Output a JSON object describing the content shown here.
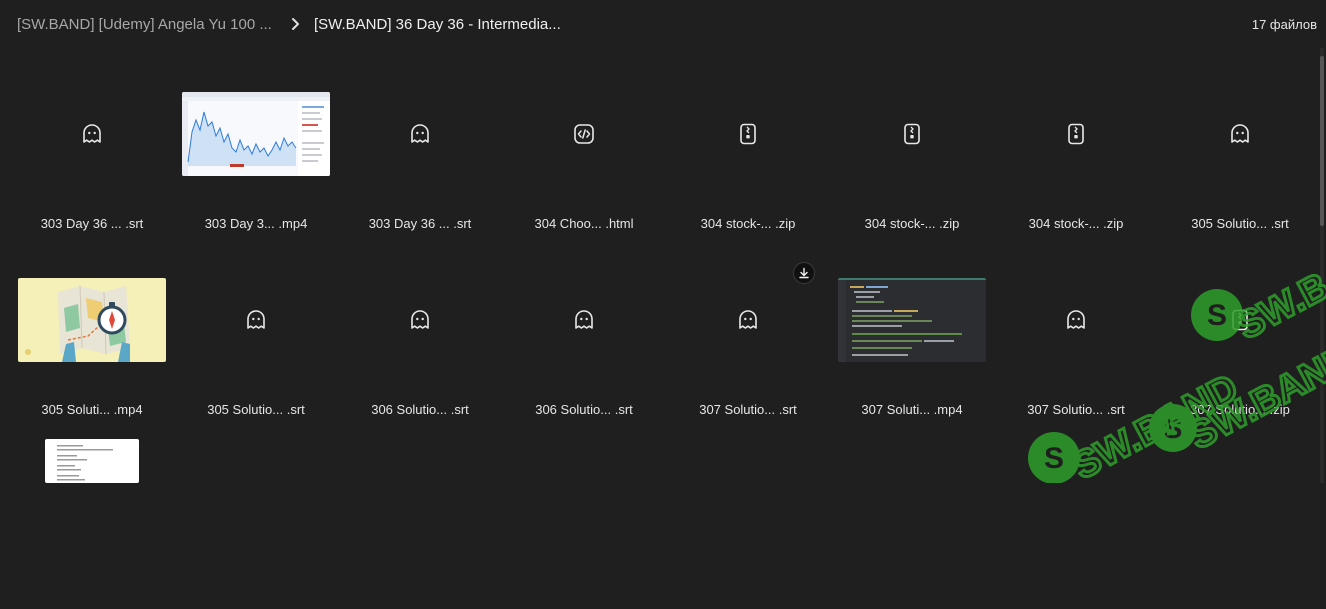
{
  "breadcrumb": {
    "parent": "[SW.BAND] [Udemy] Angela Yu 100 ...",
    "current": "[SW.BAND] 36 Day 36 - Intermedia..."
  },
  "file_count": "17 файлов",
  "files": [
    {
      "name": "303 Day 36 ... .srt",
      "thumb": "ghost-icon"
    },
    {
      "name": "303 Day 3... .mp4",
      "thumb": "chart-screenshot"
    },
    {
      "name": "303 Day 36 ... .srt",
      "thumb": "ghost-icon"
    },
    {
      "name": "304 Choo... .html",
      "thumb": "code-file-icon"
    },
    {
      "name": "304 stock-... .zip",
      "thumb": "zip-icon"
    },
    {
      "name": "304 stock-... .zip",
      "thumb": "zip-icon"
    },
    {
      "name": "304 stock-... .zip",
      "thumb": "zip-icon"
    },
    {
      "name": "305 Solutio... .srt",
      "thumb": "ghost-icon"
    },
    {
      "name": "305 Soluti... .mp4",
      "thumb": "map-illustration"
    },
    {
      "name": "305 Solutio... .srt",
      "thumb": "ghost-icon"
    },
    {
      "name": "306 Solutio... .srt",
      "thumb": "ghost-icon"
    },
    {
      "name": "306 Solutio... .srt",
      "thumb": "ghost-icon"
    },
    {
      "name": "307 Solutio... .srt",
      "thumb": "ghost-icon"
    },
    {
      "name": "307 Soluti... .mp4",
      "thumb": "code-screenshot"
    },
    {
      "name": "307 Solutio... .srt",
      "thumb": "ghost-icon"
    },
    {
      "name": "307 Solutio... .zip",
      "thumb": "zip-icon"
    },
    {
      "name": "",
      "thumb": "document-preview"
    }
  ],
  "watermark_text": "SW.BAND",
  "colors": {
    "background": "#1f1f20",
    "text": "#e6e6e6",
    "muted_text": "#a7a7a7",
    "watermark_green": "#2f9e2b"
  }
}
